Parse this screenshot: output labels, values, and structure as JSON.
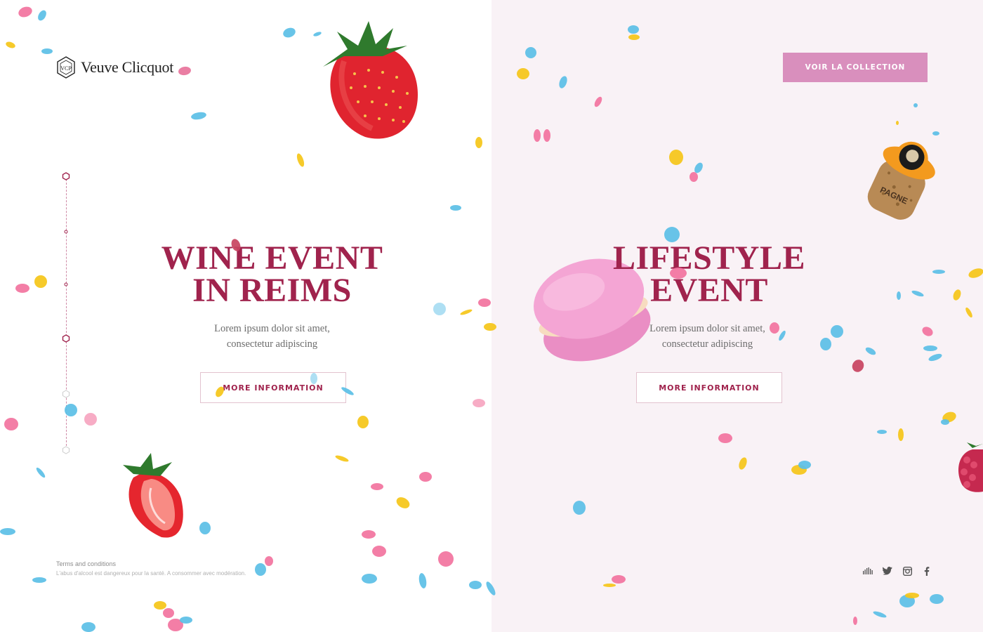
{
  "brand": {
    "name": "Veuve Clicquot",
    "accent": "#a0234d",
    "cta_color": "#d98fbd"
  },
  "header": {
    "cta_label": "VOIR LA COLLECTION"
  },
  "left_panel": {
    "title_line1": "WINE EVENT",
    "title_line2": "IN REIMS",
    "subtitle_line1": "Lorem ipsum dolor sit amet,",
    "subtitle_line2": "consectetur adipiscing",
    "button_label": "MORE INFORMATION"
  },
  "right_panel": {
    "title_line1": "LIFESTYLE",
    "title_line2": "EVENT",
    "subtitle_line1": "Lorem ipsum dolor sit amet,",
    "subtitle_line2": "consectetur adipiscing",
    "button_label": "MORE INFORMATION"
  },
  "footer": {
    "terms_label": "Terms and conditions",
    "notice": "L'abus d'alcool est dangereux pour la santé. A consommer avec modération."
  },
  "social": [
    "soundcloud-icon",
    "twitter-icon",
    "instagram-icon",
    "facebook-icon"
  ],
  "decor": [
    "strawberry",
    "strawberry-half",
    "macaron",
    "champagne-cork",
    "raspberry"
  ]
}
